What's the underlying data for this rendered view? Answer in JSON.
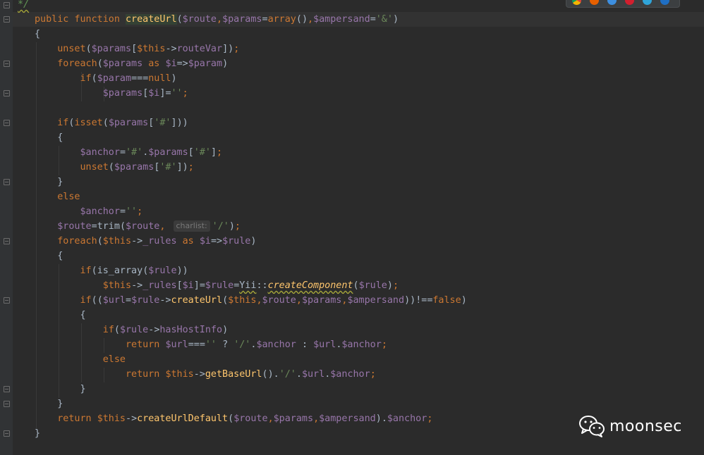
{
  "editor": {
    "language": "PHP",
    "font_colors": {
      "keyword": "#cc7832",
      "variable": "#9876aa",
      "function": "#ffc66d",
      "string": "#6a8759",
      "plain": "#a9b7c6",
      "comment": "#629755"
    },
    "lines": [
      "     */",
      "public function createUrl($route,$params=array(),$ampersand='&')",
      "{",
      "    unset($params[$this->routeVar]);",
      "    foreach($params as $i=>$param)",
      "        if($param===null)",
      "            $params[$i]='';",
      "",
      "    if(isset($params['#']))",
      "    {",
      "        $anchor='#'.$params['#'];",
      "        unset($params['#']);",
      "    }",
      "    else",
      "        $anchor='';",
      "    $route=trim($route, charlist: '/');",
      "    foreach($this->_rules as $i=>$rule)",
      "    {",
      "        if(is_array($rule))",
      "            $this->_rules[$i]=$rule=Yii::createComponent($rule);",
      "        if(($url=$rule->createUrl($this,$route,$params,$ampersand))!==false)",
      "        {",
      "            if($rule->hasHostInfo)",
      "                return $url==='' ? '/'.$anchor : $url.$anchor;",
      "            else",
      "                return $this->getBaseUrl().'/'.$url.$anchor;",
      "        }",
      "    }",
      "    return $this->createUrlDefault($route,$params,$ampersand).$anchor;",
      "}"
    ],
    "parameter_hint": "charlist:"
  },
  "browser_icons": [
    "chrome-icon",
    "firefox-icon",
    "safari-icon",
    "opera-icon",
    "edge-icon",
    "ie-icon"
  ],
  "watermark": {
    "icon": "wechat-icon",
    "text": "moonsec"
  }
}
